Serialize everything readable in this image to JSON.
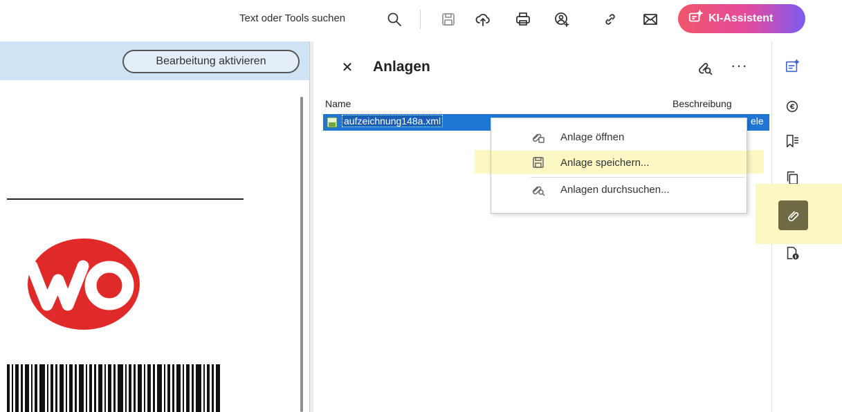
{
  "toolbar": {
    "search_label": "Text oder Tools suchen",
    "ai_assistant_label": "KI-Assistent",
    "ai_gradient": [
      "#f0566a",
      "#e34b9e",
      "#7b5bf0"
    ],
    "icons": [
      "search-icon",
      "save-icon",
      "upload-icon",
      "print-icon",
      "share-user-icon",
      "link-icon",
      "mail-icon"
    ]
  },
  "document": {
    "edit_button_label": "Bearbeitung aktivieren",
    "banner_color": "#cfe3f5",
    "logo_text": "WO",
    "logo_color": "#e02a2a"
  },
  "attachments_panel": {
    "title": "Anlagen",
    "columns": {
      "name": "Name",
      "description": "Beschreibung"
    },
    "files": [
      {
        "name": "aufzeichnung148a.xml",
        "description": "ele"
      }
    ],
    "selected_row_color": "#1f77d3"
  },
  "context_menu": {
    "items": [
      {
        "label": "Anlage öffnen",
        "icon": "open-attachment-icon"
      },
      {
        "label": "Anlage speichern...",
        "icon": "save-attachment-icon"
      },
      {
        "label": "Anlagen durchsuchen...",
        "icon": "search-attachments-icon"
      }
    ],
    "highlight_color": "#fbf8c4"
  },
  "right_rail": {
    "icons": [
      "comment-edit-icon",
      "stamp-icon",
      "bookmark-list-icon",
      "pages-icon",
      "attachment-icon",
      "document-properties-icon"
    ],
    "active": "attachment-icon",
    "active_color": "#6e6a44"
  }
}
